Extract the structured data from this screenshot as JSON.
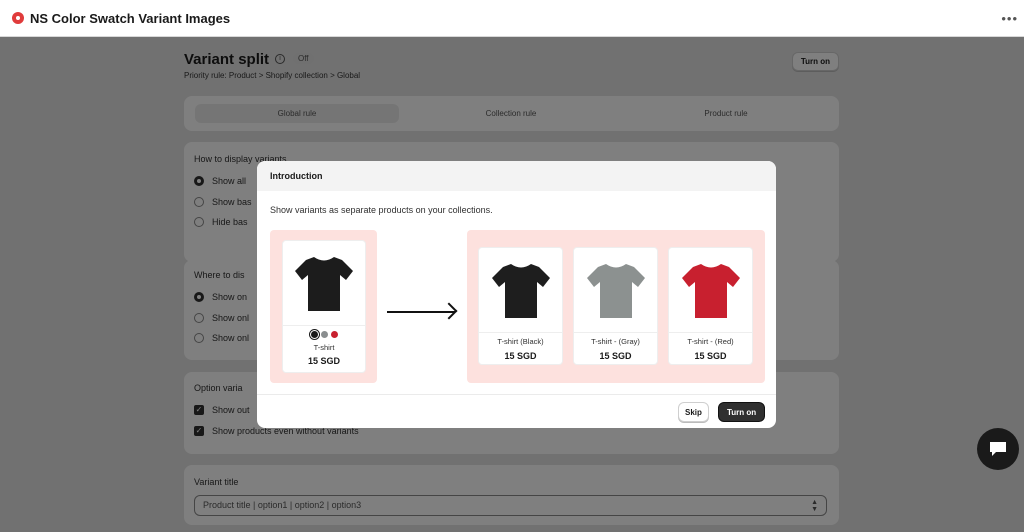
{
  "app": {
    "title": "NS Color Swatch Variant Images",
    "more_label": "•••"
  },
  "page": {
    "title": "Variant split",
    "status_badge": "Off",
    "priority_rule": "Priority rule: Product > Shopify collection > Global",
    "turn_on_label": "Turn on",
    "tabs": [
      "Global rule",
      "Collection rule",
      "Product rule"
    ],
    "display_section": {
      "title": "How to display variants",
      "options": [
        "Show all",
        "Show bas",
        "Hide bas"
      ]
    },
    "where_section": {
      "title": "Where to dis",
      "options": [
        "Show on",
        "Show onl",
        "Show onl"
      ]
    },
    "option_section": {
      "title": "Option varia",
      "checks": [
        "Show out",
        "Show products even without variants"
      ]
    },
    "variant_title": {
      "title": "Variant title",
      "value": "Product title | option1 | option2 | option3"
    }
  },
  "modal": {
    "title": "Introduction",
    "description": "Show variants as separate products on your collections.",
    "source_product": {
      "name": "T-shirt",
      "price": "15 SGD",
      "swatches": [
        "#1a1a1a",
        "#8a8e8f",
        "#c8202f"
      ]
    },
    "split_products": [
      {
        "name": "T-shirt (Black)",
        "price": "15 SGD",
        "color": "#1e1e1e"
      },
      {
        "name": "T-shirt - (Gray)",
        "price": "15 SGD",
        "color": "#8c9190"
      },
      {
        "name": "T-shirt - (Red)",
        "price": "15 SGD",
        "color": "#c8202f"
      }
    ],
    "skip_label": "Skip",
    "turn_on_label": "Turn on"
  }
}
